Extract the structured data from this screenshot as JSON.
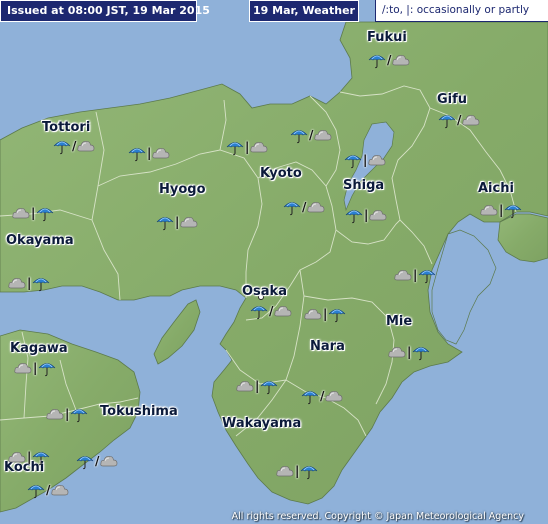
{
  "header": {
    "issued": "Issued at 08:00 JST, 19 Mar 2015",
    "day": "19 Mar, Weather",
    "legend": "/:to,  |: occasionally or partly"
  },
  "colors": {
    "sea": "#8fb1d9",
    "land": "#8aae6c",
    "header_bg": "#1d2870",
    "umbrella": "#2a7fd0",
    "cloud": "#b5b5b5"
  },
  "prefectures": [
    {
      "name": "Fukui",
      "id": "fukui"
    },
    {
      "name": "Tottori",
      "id": "tottori"
    },
    {
      "name": "Gifu",
      "id": "gifu"
    },
    {
      "name": "Kyoto",
      "id": "kyoto"
    },
    {
      "name": "Hyogo",
      "id": "hyogo"
    },
    {
      "name": "Shiga",
      "id": "shiga"
    },
    {
      "name": "Aichi",
      "id": "aichi"
    },
    {
      "name": "Okayama",
      "id": "okayama"
    },
    {
      "name": "Osaka",
      "id": "osaka"
    },
    {
      "name": "Mie",
      "id": "mie"
    },
    {
      "name": "Kagawa",
      "id": "kagawa"
    },
    {
      "name": "Nara",
      "id": "nara"
    },
    {
      "name": "Tokushima",
      "id": "tokushima"
    },
    {
      "name": "Wakayama",
      "id": "wakayama"
    },
    {
      "name": "Kochi",
      "id": "kochi"
    }
  ],
  "forecasts": [
    {
      "first": "rain-icon",
      "sep": "/",
      "second": "cloud-icon"
    },
    {
      "first": "rain-icon",
      "sep": "/",
      "second": "cloud-icon"
    },
    {
      "first": "rain-icon",
      "sep": "|",
      "second": "cloud-icon"
    },
    {
      "first": "rain-icon",
      "sep": "/",
      "second": "cloud-icon"
    },
    {
      "first": "rain-icon",
      "sep": "|",
      "second": "cloud-icon"
    },
    {
      "first": "rain-icon",
      "sep": "|",
      "second": "cloud-icon"
    },
    {
      "first": "rain-icon",
      "sep": "/",
      "second": "cloud-icon"
    },
    {
      "first": "rain-icon",
      "sep": "|",
      "second": "cloud-icon"
    },
    {
      "first": "cloud-icon",
      "sep": "|",
      "second": "rain-icon"
    },
    {
      "first": "rain-icon",
      "sep": "/",
      "second": "cloud-icon"
    },
    {
      "first": "rain-icon",
      "sep": "|",
      "second": "cloud-icon"
    },
    {
      "first": "cloud-icon",
      "sep": "|",
      "second": "rain-icon"
    },
    {
      "first": "cloud-icon",
      "sep": "|",
      "second": "rain-icon"
    },
    {
      "first": "cloud-icon",
      "sep": "|",
      "second": "rain-icon"
    },
    {
      "first": "cloud-icon",
      "sep": "|",
      "second": "rain-icon"
    },
    {
      "first": "rain-icon",
      "sep": "/",
      "second": "cloud-icon"
    },
    {
      "first": "cloud-icon",
      "sep": "|",
      "second": "rain-icon"
    },
    {
      "first": "cloud-icon",
      "sep": "|",
      "second": "rain-icon"
    },
    {
      "first": "cloud-icon",
      "sep": "|",
      "second": "rain-icon"
    },
    {
      "first": "cloud-icon",
      "sep": "|",
      "second": "rain-icon"
    },
    {
      "first": "rain-icon",
      "sep": "/",
      "second": "cloud-icon"
    },
    {
      "first": "cloud-icon",
      "sep": "|",
      "second": "rain-icon"
    },
    {
      "first": "rain-icon",
      "sep": "/",
      "second": "cloud-icon"
    },
    {
      "first": "cloud-icon",
      "sep": "|",
      "second": "rain-icon"
    },
    {
      "first": "rain-icon",
      "sep": "/",
      "second": "cloud-icon"
    }
  ],
  "copyright": "All rights reserved. Copyright © Japan Meteorological Agency"
}
